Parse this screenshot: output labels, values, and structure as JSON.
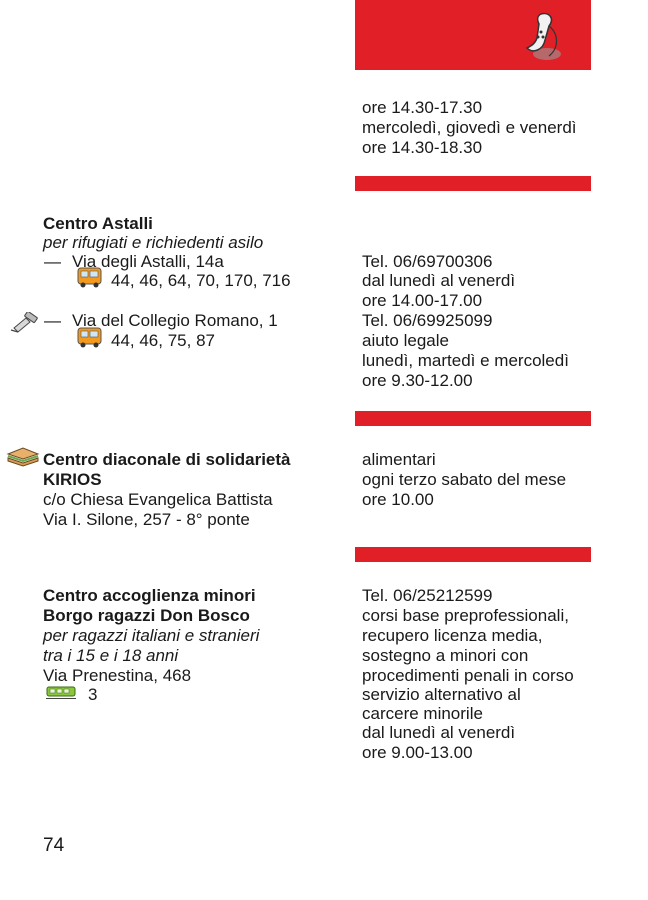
{
  "header": {
    "icon": "telephone-icon",
    "color": "#e01f26",
    "hours_lines": [
      "ore 14.30-17.30",
      "mercoledì, giovedì e venerdì",
      "ore 14.30-18.30"
    ]
  },
  "entries": [
    {
      "name_lines": [
        "Centro Astalli"
      ],
      "subtitle": "per rifugiati e richiedenti asilo",
      "locations": [
        {
          "dash": "—",
          "address": "Via degli Astalli, 14a",
          "transport_icon": "bus-icon",
          "lines": "44, 46, 64, 70, 170, 716"
        },
        {
          "dash": "—",
          "address": "Via del Collegio Romano, 1",
          "transport_icon": "bus-icon",
          "lines": "44, 46, 75, 87",
          "side_icon": "legal-stamp-icon"
        }
      ],
      "info_lines": [
        "Tel. 06/69700306",
        "dal lunedì al venerdì",
        "ore 14.00-17.00",
        "Tel. 06/69925099",
        "aiuto legale",
        "lunedì, martedì e mercoledì",
        "ore 9.30-12.00"
      ]
    },
    {
      "side_icon": "sandwich-icon",
      "name_lines": [
        "Centro diaconale di solidarietà",
        "KIRIOS"
      ],
      "address_lines": [
        "c/o Chiesa Evangelica Battista",
        "Via I. Silone, 257 - 8° ponte"
      ],
      "info_lines": [
        "alimentari",
        "ogni terzo sabato del mese",
        "ore 10.00"
      ]
    },
    {
      "name_lines": [
        "Centro accoglienza minori",
        "Borgo ragazzi Don Bosco"
      ],
      "subtitle_lines": [
        "per ragazzi italiani e stranieri",
        "tra i 15 e i 18 anni"
      ],
      "address": "Via Prenestina, 468",
      "transport_icon": "tram-icon",
      "lines": "3",
      "info_lines": [
        "Tel. 06/25212599",
        "corsi base preprofessionali,",
        "recupero licenza media,",
        "sostegno a minori con",
        "procedimenti penali in corso",
        "servizio alternativo al",
        "carcere minorile",
        "dal lunedì al venerdì",
        "ore 9.00-13.00"
      ]
    }
  ],
  "page_number": "74"
}
